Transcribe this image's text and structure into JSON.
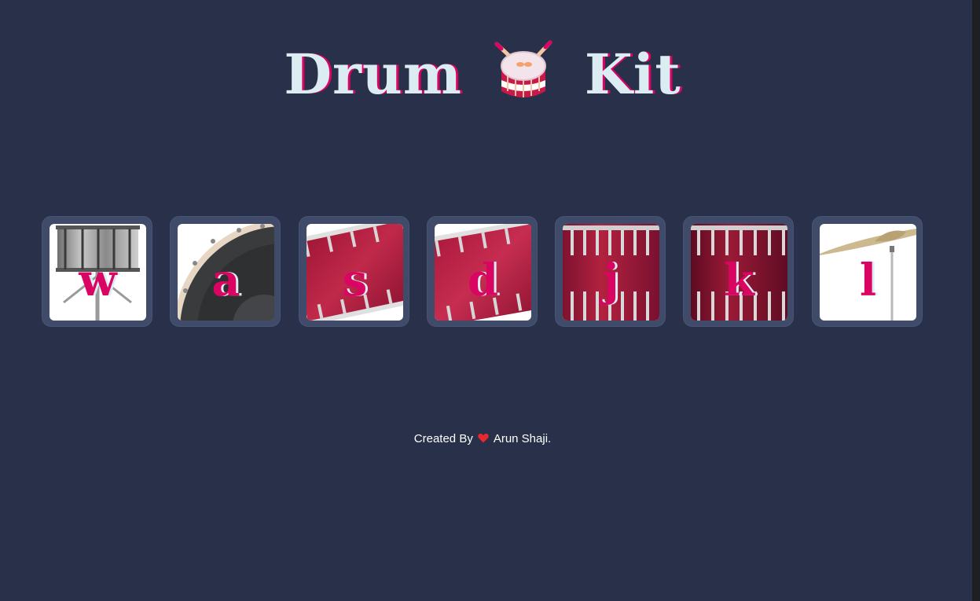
{
  "header": {
    "word_left": "Drum",
    "emoji_icon": "drum-with-drumsticks-icon",
    "word_right": "Kit"
  },
  "drums": [
    {
      "key": "w",
      "instrument_icon": "snare-drum-icon"
    },
    {
      "key": "a",
      "instrument_icon": "bass-drum-icon"
    },
    {
      "key": "s",
      "instrument_icon": "tom-drum-icon"
    },
    {
      "key": "d",
      "instrument_icon": "tom-drum-icon"
    },
    {
      "key": "j",
      "instrument_icon": "floor-tom-icon"
    },
    {
      "key": "k",
      "instrument_icon": "floor-tom-icon"
    },
    {
      "key": "l",
      "instrument_icon": "cymbal-icon"
    }
  ],
  "footer": {
    "prefix": "Created By",
    "heart_icon": "heart-icon",
    "author": "Arun Shaji."
  },
  "colors": {
    "background": "#283149",
    "button_border": "#404b69",
    "title_text": "#dbedf3",
    "accent_pink": "#da0463"
  }
}
